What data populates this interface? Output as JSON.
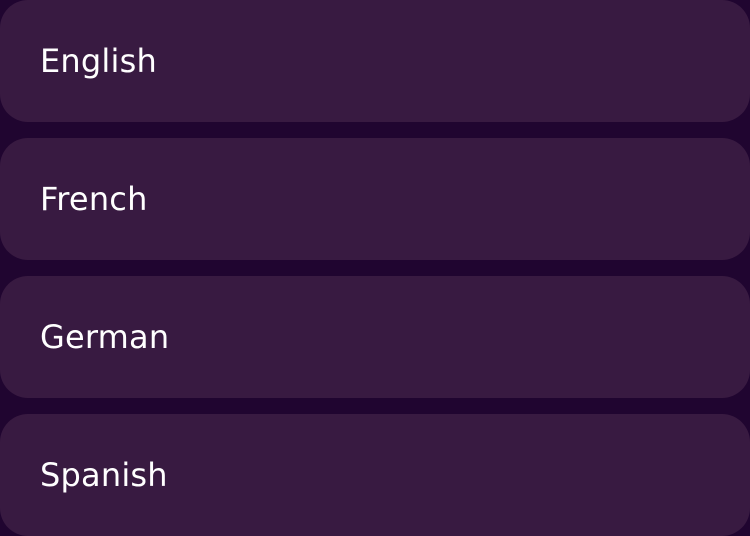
{
  "language_list": {
    "items": [
      {
        "label": "English"
      },
      {
        "label": "French"
      },
      {
        "label": "German"
      },
      {
        "label": "Spanish"
      }
    ]
  },
  "colors": {
    "background": "#200530",
    "option_background": "#381a41",
    "text": "#ffffff"
  }
}
